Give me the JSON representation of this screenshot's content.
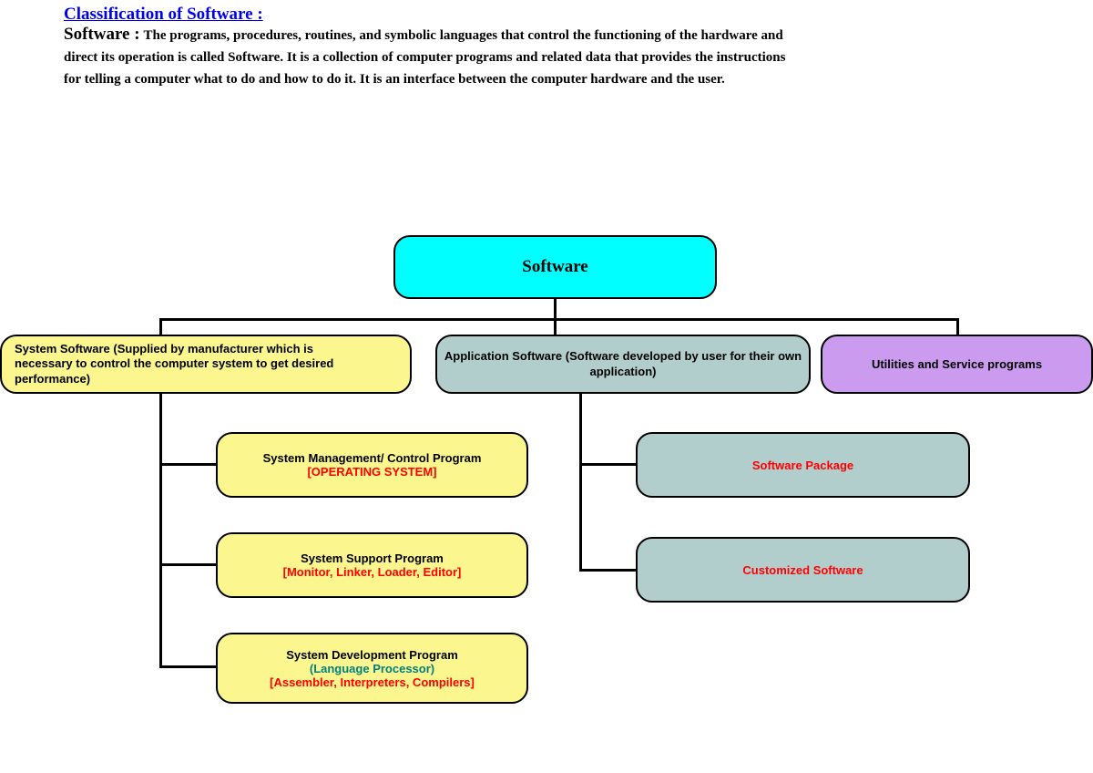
{
  "header": {
    "title": "Classification of Software :",
    "label": "Software :",
    "desc1": "The programs, procedures, routines, and symbolic languages that control the functioning of the hardware and",
    "desc2": "direct its operation is called Software. It is a collection of computer programs and related data that provides the instructions",
    "desc3": "for telling a computer what to do and how to do it. It is an interface between the computer hardware and the user."
  },
  "root": {
    "title": "Software"
  },
  "nodes": {
    "system": {
      "title": "System Software (Supplied by manufacturer which is necessary to control the computer system to get desired performance)",
      "children": {
        "management": {
          "title": "System Management/ Control Program",
          "subtitle": "[OPERATING SYSTEM]"
        },
        "support": {
          "title": "System Support Program",
          "subtitle": "[Monitor, Linker, Loader, Editor]"
        },
        "development": {
          "title": "System Development Program",
          "subtitle1": "(Language Processor)",
          "subtitle2": "[Assembler, Interpreters, Compilers]"
        }
      }
    },
    "application": {
      "title": "Application Software (Software developed by user for their own application)",
      "children": {
        "package": {
          "title": "Software Package"
        },
        "customized": {
          "title": "Customized Software"
        }
      }
    },
    "utilities": {
      "title": "Utilities and Service programs"
    }
  }
}
